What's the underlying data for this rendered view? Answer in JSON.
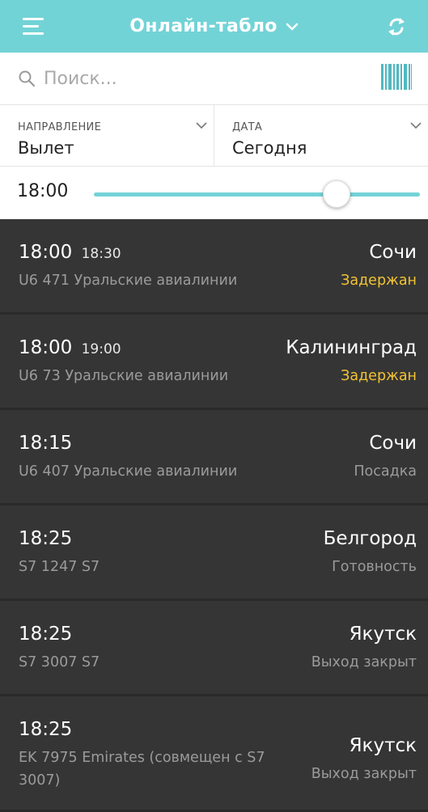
{
  "header": {
    "title": "Онлайн-табло"
  },
  "search": {
    "placeholder": "Поиск..."
  },
  "filters": {
    "direction": {
      "label": "НАПРАВЛЕНИЕ",
      "value": "Вылет"
    },
    "date": {
      "label": "ДАТА",
      "value": "Сегодня"
    }
  },
  "time_filter": {
    "value": "18:00",
    "slider_fraction": 0.745
  },
  "colors": {
    "accent": "#72d3d7",
    "delayed": "#f1c233",
    "card": "#353535"
  },
  "flights": [
    {
      "time": "18:00",
      "actual": "18:30",
      "info": "U6 471 Уральские авиалинии",
      "destination": "Сочи",
      "status": "Задержан"
    },
    {
      "time": "18:00",
      "actual": "19:00",
      "info": "U6 73 Уральские авиалинии",
      "destination": "Калининград",
      "status": "Задержан"
    },
    {
      "time": "18:15",
      "actual": "",
      "info": "U6 407 Уральские авиалинии",
      "destination": "Сочи",
      "status": "Посадка"
    },
    {
      "time": "18:25",
      "actual": "",
      "info": "S7 1247 S7",
      "destination": "Белгород",
      "status": "Готовность"
    },
    {
      "time": "18:25",
      "actual": "",
      "info": "S7 3007 S7",
      "destination": "Якутск",
      "status": "Выход закрыт"
    },
    {
      "time": "18:25",
      "actual": "",
      "info": "EK 7975 Emirates (совмещен с S7 3007)",
      "destination": "Якутск",
      "status": "Выход закрыт"
    }
  ]
}
